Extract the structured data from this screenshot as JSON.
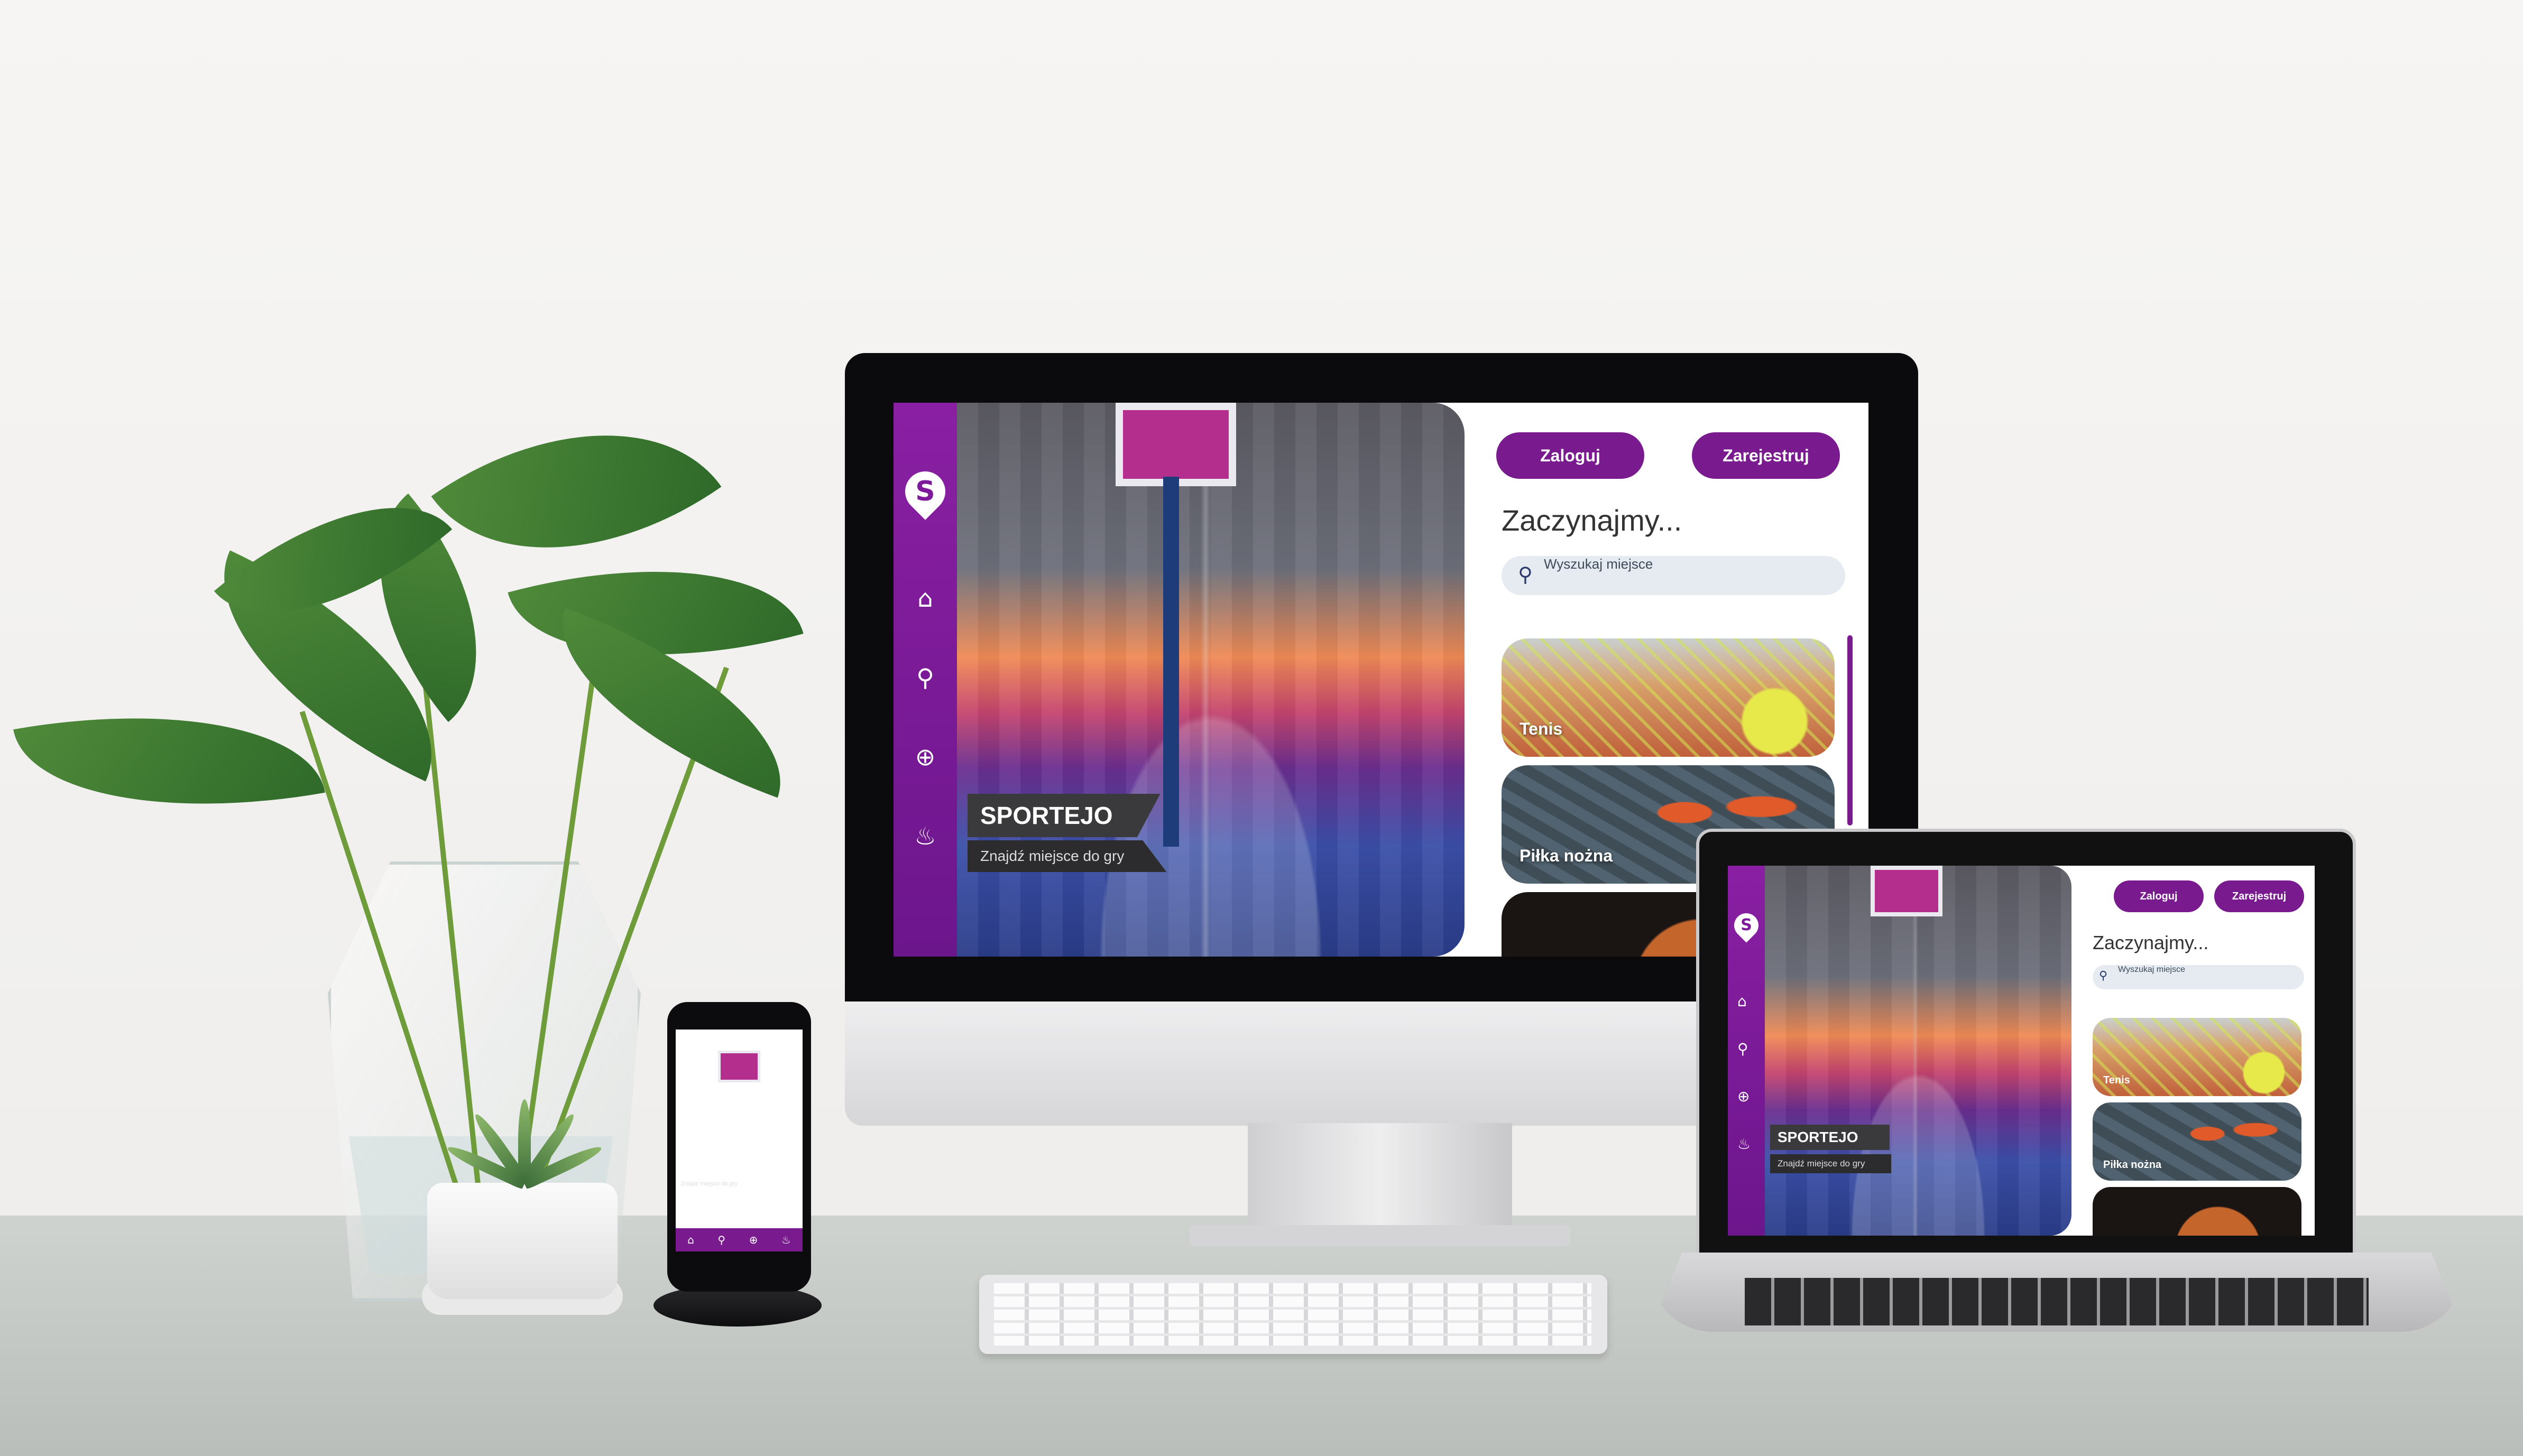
{
  "app": {
    "brand_name": "SPORTEJO",
    "tagline": "Znajdź miejsce do gry",
    "logo_letter": "S",
    "accent_color": "#7a1a8f",
    "nav_icons": [
      "home-icon",
      "search-icon",
      "plus-circle-icon",
      "fire-icon"
    ],
    "buttons": {
      "login": "Zaloguj",
      "register": "Zarejestruj"
    },
    "heading": "Zaczynajmy...",
    "search": {
      "placeholder": "Wyszukaj miejsce"
    },
    "categories": [
      {
        "label": "Tenis"
      },
      {
        "label": "Piłka nożna"
      },
      {
        "label": ""
      }
    ]
  }
}
